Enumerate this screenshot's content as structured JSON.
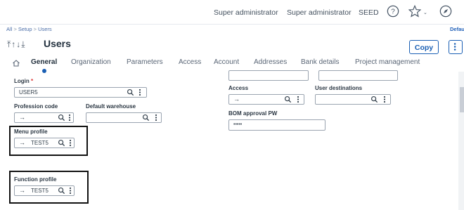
{
  "topbar": {
    "user1": "Super administrator",
    "user2": "Super administrator",
    "folder": "SEED",
    "icons": [
      "help-icon",
      "star-icon",
      "compass-icon"
    ]
  },
  "breadcrumb": {
    "items": [
      "All",
      "Setup",
      "Users"
    ],
    "right": "Defau"
  },
  "header": {
    "nav_arrows": "⤒↑↓⤓",
    "title": "Users",
    "copy_label": "Copy"
  },
  "tabs": {
    "home_icon": "home-icon",
    "items": [
      "General",
      "Organization",
      "Parameters",
      "Access",
      "Account",
      "Addresses",
      "Bank details",
      "Project management"
    ],
    "active": "General"
  },
  "form": {
    "login": {
      "label": "Login",
      "required": "*",
      "value": "USER5"
    },
    "profession_code": {
      "label": "Profession code",
      "value": ""
    },
    "default_warehouse": {
      "label": "Default warehouse",
      "value": ""
    },
    "menu_profile": {
      "label": "Menu profile",
      "value": "TEST5"
    },
    "function_profile": {
      "label": "Function profile",
      "value": "TEST5"
    },
    "access": {
      "label": "Access",
      "value": ""
    },
    "user_destinations": {
      "label": "User destinations",
      "value": ""
    },
    "bom_approval_pw": {
      "label": "BOM approval PW",
      "value": "•••••"
    }
  },
  "colors": {
    "accent": "#1a5fb4",
    "highlight_border": "#111111"
  }
}
